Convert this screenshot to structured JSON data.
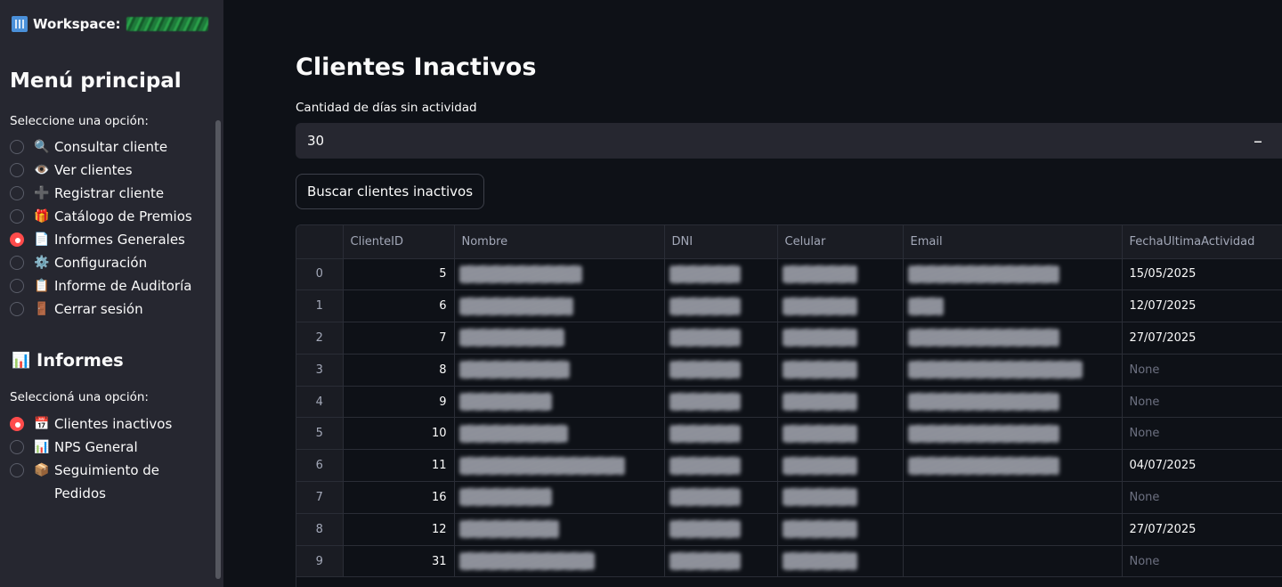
{
  "sidebar": {
    "workspace_label": "Workspace:",
    "menu_title": "Menú principal",
    "menu_prompt": "Seleccione una opción:",
    "menu_items": [
      {
        "label": "Consultar cliente",
        "icon": "🔍",
        "icon_name": "magnifier-icon",
        "selected": false
      },
      {
        "label": "Ver clientes",
        "icon": "👁️",
        "icon_name": "eye-icon",
        "selected": false
      },
      {
        "label": "Registrar cliente",
        "icon": "➕",
        "icon_name": "plus-icon",
        "selected": false
      },
      {
        "label": "Catálogo de Premios",
        "icon": "🎁",
        "icon_name": "gift-icon",
        "selected": false
      },
      {
        "label": "Informes Generales",
        "icon": "📄",
        "icon_name": "document-icon",
        "selected": true
      },
      {
        "label": "Configuración",
        "icon": "⚙️",
        "icon_name": "gear-icon",
        "selected": false
      },
      {
        "label": "Informe de Auditoría",
        "icon": "📋",
        "icon_name": "clipboard-icon",
        "selected": false
      },
      {
        "label": "Cerrar sesión",
        "icon": "🚪",
        "icon_name": "door-icon",
        "selected": false
      }
    ],
    "reports_title": "Informes",
    "reports_icon": "📊",
    "reports_prompt": "Seleccioná una opción:",
    "report_items": [
      {
        "label": "Clientes inactivos",
        "icon": "📅",
        "icon_name": "calendar-icon",
        "selected": true
      },
      {
        "label": "NPS General",
        "icon": "📊",
        "icon_name": "bar-chart-icon",
        "selected": false
      },
      {
        "label": "Seguimiento de Pedidos",
        "icon": "📦",
        "icon_name": "package-icon",
        "selected": false
      }
    ]
  },
  "main": {
    "title": "Clientes Inactivos",
    "days_label": "Cantidad de días sin actividad",
    "days_value": "30",
    "decrement_symbol": "–",
    "search_button": "Buscar clientes inactivos"
  },
  "table": {
    "columns": [
      "",
      "ClienteID",
      "Nombre",
      "DNI",
      "Celular",
      "Email",
      "FechaUltimaActividad"
    ],
    "rows": [
      {
        "idx": "0",
        "id": "5",
        "fecha": "15/05/2025"
      },
      {
        "idx": "1",
        "id": "6",
        "fecha": "12/07/2025"
      },
      {
        "idx": "2",
        "id": "7",
        "fecha": "27/07/2025"
      },
      {
        "idx": "3",
        "id": "8",
        "fecha": "None"
      },
      {
        "idx": "4",
        "id": "9",
        "fecha": "None"
      },
      {
        "idx": "5",
        "id": "10",
        "fecha": "None"
      },
      {
        "idx": "6",
        "id": "11",
        "fecha": "04/07/2025"
      },
      {
        "idx": "7",
        "id": "16",
        "fecha": "None"
      },
      {
        "idx": "8",
        "id": "12",
        "fecha": "27/07/2025"
      },
      {
        "idx": "9",
        "id": "31",
        "fecha": "None"
      }
    ]
  },
  "colors": {
    "background": "#0e1117",
    "sidebar": "#262730",
    "accent": "#ff4b4b"
  }
}
